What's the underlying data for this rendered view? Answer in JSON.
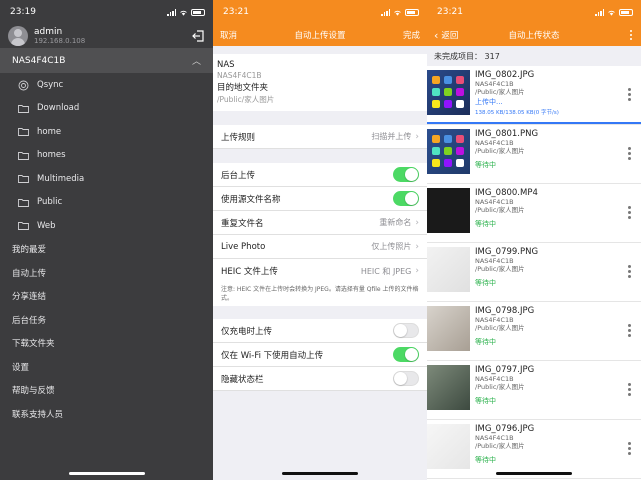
{
  "panel1": {
    "time": "23:19",
    "account": {
      "name": "admin",
      "ip": "192.168.0.108"
    },
    "nas_name": "NAS4F4C1B",
    "folders": [
      "Qsync",
      "Download",
      "home",
      "homes",
      "Multimedia",
      "Public",
      "Web"
    ],
    "menu": [
      "我的最爱",
      "自动上传",
      "分享连结",
      "后台任务",
      "下载文件夹",
      "设置",
      "帮助与反馈",
      "联系支持人员"
    ]
  },
  "panel2": {
    "time": "23:21",
    "nav": {
      "cancel": "取消",
      "title": "自动上传设置",
      "done": "完成"
    },
    "nas": {
      "label": "NAS",
      "value": "NAS4F4C1B",
      "dest_label": "目的地文件夹",
      "dest_value": "/Public/家人图片"
    },
    "upload_rule": {
      "label": "上传规则",
      "value": "扫描并上传"
    },
    "background": {
      "label": "后台上传"
    },
    "use_src_name": {
      "label": "使用源文件名称"
    },
    "dup_name": {
      "label": "重复文件名",
      "value": "重新命名"
    },
    "live_photo": {
      "label": "Live Photo",
      "value": "仅上传照片"
    },
    "heic": {
      "label": "HEIC 文件上传",
      "value": "HEIC 和 JPEG"
    },
    "note": "注意: HEIC 文件在上传时会转换为 JPEG。请选择有量 Qfile 上传的文件格式。",
    "charging_only": {
      "label": "仅充电时上传"
    },
    "wifi_only": {
      "label": "仅在 Wi-Fi 下使用自动上传"
    },
    "hide_status": {
      "label": "隐藏状态栏"
    }
  },
  "panel3": {
    "time": "23:21",
    "nav": {
      "back": "返回",
      "title": "自动上传状态"
    },
    "summary": "未完成项目：  317",
    "files": [
      {
        "name": "IMG_0802.JPG",
        "nas": "NAS4F4C1B",
        "path": "/Public/家人图片",
        "status": "上传中...",
        "progress": "138.05 KB/138.05 KB(0 字节/s)"
      },
      {
        "name": "IMG_0801.PNG",
        "nas": "NAS4F4C1B",
        "path": "/Public/家人图片",
        "status": "等待中"
      },
      {
        "name": "IMG_0800.MP4",
        "nas": "NAS4F4C1B",
        "path": "/Public/家人图片",
        "status": "等待中"
      },
      {
        "name": "IMG_0799.PNG",
        "nas": "NAS4F4C1B",
        "path": "/Public/家人图片",
        "status": "等待中"
      },
      {
        "name": "IMG_0798.JPG",
        "nas": "NAS4F4C1B",
        "path": "/Public/家人图片",
        "status": "等待中"
      },
      {
        "name": "IMG_0797.JPG",
        "nas": "NAS4F4C1B",
        "path": "/Public/家人图片",
        "status": "等待中"
      },
      {
        "name": "IMG_0796.JPG",
        "nas": "NAS4F4C1B",
        "path": "/Public/家人图片",
        "status": "等待中"
      }
    ]
  },
  "colors": {
    "accent": "#f58b1f",
    "toggle_on": "#4cd964",
    "waiting": "#2bb24c",
    "uploading": "#3478f6"
  }
}
